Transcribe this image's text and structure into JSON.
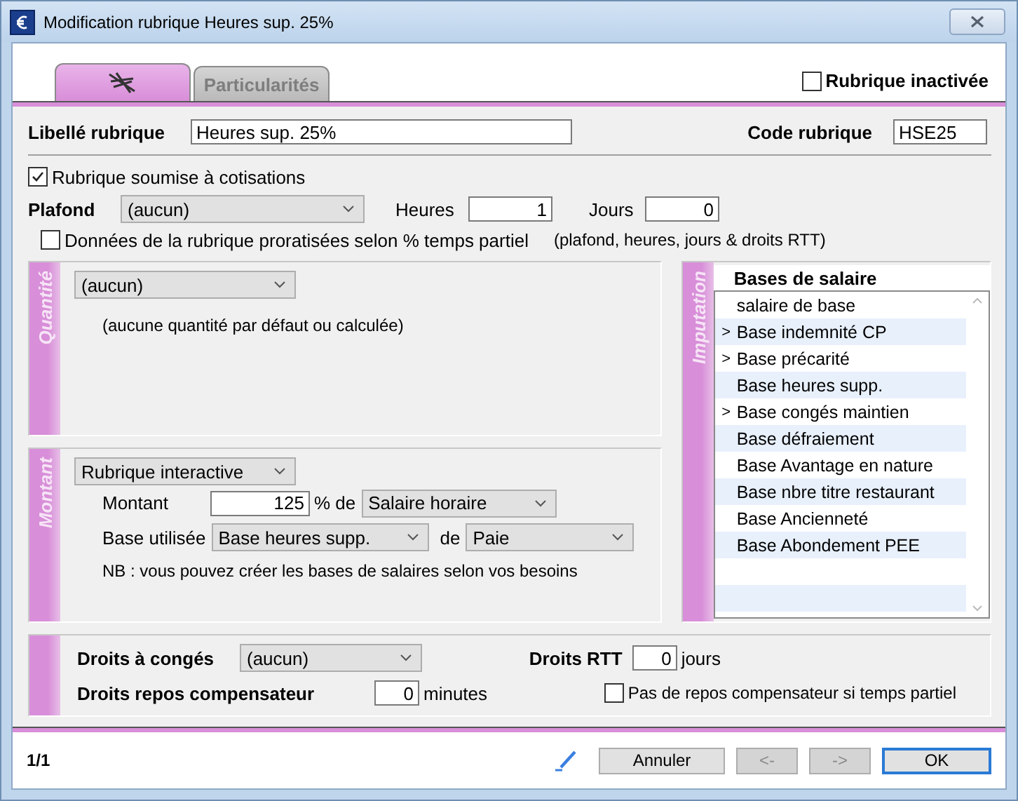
{
  "window": {
    "title": "Modification rubrique Heures sup. 25%"
  },
  "tabs": [
    {
      "kind": "icon",
      "selected": true
    },
    {
      "kind": "text",
      "label": "Particularités",
      "selected": false
    }
  ],
  "inactive": {
    "label": "Rubrique inactivée",
    "checked": false
  },
  "libelle": {
    "label": "Libellé rubrique",
    "value": "Heures sup. 25%"
  },
  "code": {
    "label": "Code rubrique",
    "value": "HSE25"
  },
  "cotisations": {
    "label": "Rubrique soumise à cotisations",
    "checked": true
  },
  "plafond": {
    "label": "Plafond",
    "value": "(aucun)",
    "heures_label": "Heures",
    "heures": "1",
    "jours_label": "Jours",
    "jours": "0"
  },
  "prorata": {
    "label": "Données de la rubrique proratisées selon % temps partiel",
    "checked": false,
    "note": "(plafond, heures, jours & droits RTT)"
  },
  "quantite": {
    "title": "Quantité",
    "select": "(aucun)",
    "note": "(aucune quantité par défaut ou calculée)"
  },
  "montant": {
    "title": "Montant",
    "select": "Rubrique interactive",
    "montant_label": "Montant",
    "montant": "125",
    "pct_label": "% de",
    "pct_of": "Salaire horaire",
    "base_label": "Base utilisée",
    "base": "Base heures supp.",
    "de_label": "de",
    "source": "Paie",
    "nb": "NB : vous pouvez créer les bases de salaires selon vos besoins"
  },
  "imputation": {
    "title": "Imputation",
    "heading": "Bases de salaire",
    "items": [
      {
        "label": "salaire de base"
      },
      {
        "marker": ">",
        "label": "Base indemnité CP"
      },
      {
        "marker": ">",
        "label": "Base précarité"
      },
      {
        "label": "Base heures supp."
      },
      {
        "marker": ">",
        "label": "Base congés maintien"
      },
      {
        "label": "Base défraiement"
      },
      {
        "label": "Base Avantage en nature"
      },
      {
        "label": "Base nbre titre restaurant"
      },
      {
        "label": "Base Ancienneté"
      },
      {
        "label": "Base Abondement PEE"
      }
    ]
  },
  "droits": {
    "conges_label": "Droits à congés",
    "conges": "(aucun)",
    "rtt_label": "Droits RTT",
    "rtt": "0",
    "rtt_unit": "jours",
    "repos_label": "Droits repos compensateur",
    "repos": "0",
    "repos_unit": "minutes",
    "no_repos": {
      "label": "Pas de repos compensateur si temps partiel",
      "checked": false
    }
  },
  "footer": {
    "page": "1/1",
    "buttons": [
      {
        "label": "Annuler",
        "disabled": false,
        "default": false
      },
      {
        "label": "<-",
        "disabled": true,
        "default": false
      },
      {
        "label": "->",
        "disabled": true,
        "default": false
      },
      {
        "label": "OK",
        "disabled": false,
        "default": true
      }
    ]
  }
}
